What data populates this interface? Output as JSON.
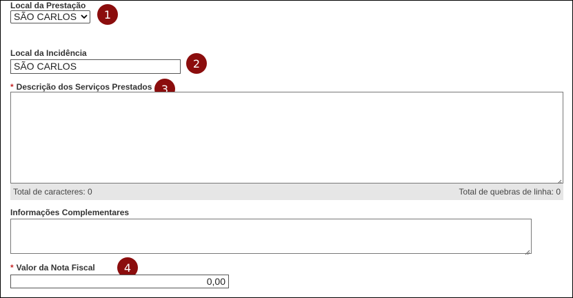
{
  "local_prestacao": {
    "label": "Local da Prestação",
    "selected": "SÃO CARLOS"
  },
  "local_incidencia": {
    "label": "Local da Incidência",
    "value": "SÃO CARLOS"
  },
  "descricao": {
    "required_mark": "*",
    "label": "Descrição dos Serviços Prestados",
    "value": "",
    "total_caracteres": "Total de caracteres: 0",
    "total_quebras": "Total de quebras de linha: 0"
  },
  "info_complementares": {
    "label": "Informações Complementares",
    "value": ""
  },
  "valor_nota": {
    "required_mark": "*",
    "label": "Valor da Nota Fiscal",
    "value": "0,00"
  },
  "annotations": [
    "1",
    "2",
    "3",
    "4"
  ],
  "colors": {
    "badge": "#8b0d0d",
    "required": "#c62828",
    "counter_bar": "#e6e6e6"
  }
}
